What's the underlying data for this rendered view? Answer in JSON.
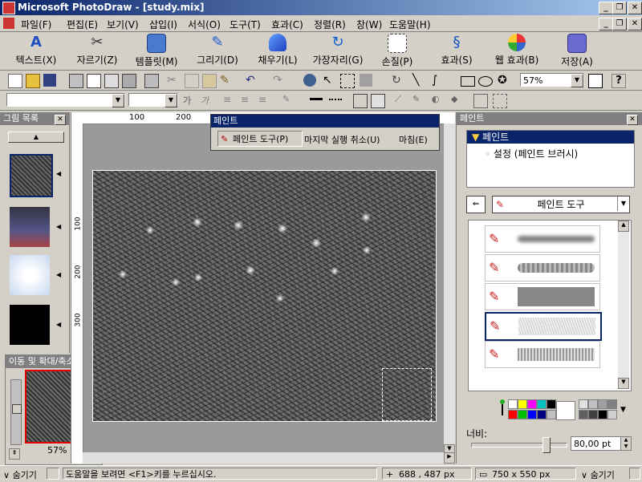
{
  "window": {
    "title": "Microsoft PhotoDraw - [study.mix]"
  },
  "menu": [
    "파일(F)",
    "편집(E)",
    "보기(V)",
    "삽입(I)",
    "서식(O)",
    "도구(T)",
    "효과(C)",
    "정렬(R)",
    "창(W)",
    "도움말(H)"
  ],
  "big_toolbar": [
    "텍스트(X)",
    "자르기(Z)",
    "템플릿(M)",
    "그리기(D)",
    "채우기(L)",
    "가장자리(G)",
    "손질(P)",
    "효과(S)",
    "웹 효과(B)",
    "저장(A)"
  ],
  "zoom": {
    "value": "57%"
  },
  "picture_list": {
    "title": "그림 목록"
  },
  "navigator": {
    "title": "이동 및 확대/축소",
    "zoom": "57%"
  },
  "ruler": {
    "h_labels": [
      "100",
      "200"
    ],
    "v_labels": [
      "100",
      "200",
      "300"
    ]
  },
  "paint_float": {
    "title": "페인트",
    "buttons": [
      "페인트 도구(P)",
      "마지막 실행 취소(U)",
      "마침(E)"
    ]
  },
  "right_panel": {
    "title": "페인트",
    "tree": {
      "root": "페인트",
      "child": "설정 (페인트 브러시)"
    },
    "tool_select": "페인트 도구",
    "width_label": "너비:",
    "width_value": "80,00 pt",
    "slider_fraction": 0.8
  },
  "palette_colors": [
    "#ffffff",
    "#ffff00",
    "#ff00ff",
    "#00c0c0",
    "#000000",
    "#ff0000",
    "#00c000",
    "#0000ff",
    "#000080",
    "#c0c0c0"
  ],
  "palette_grays": [
    "#e0e0e0",
    "#c0c0c0",
    "#a0a0a0",
    "#808080",
    "#606060",
    "#404040",
    "#000000",
    "#d0d0d0"
  ],
  "status": {
    "hide_left": "숨기기",
    "help": "도움말을 보려면 <F1>키를 누르십시오.",
    "position": "688 , 487  px",
    "size": "750 x 550  px",
    "hide_right": "숨기기"
  }
}
